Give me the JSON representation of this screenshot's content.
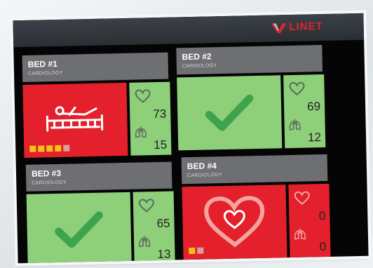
{
  "brand": {
    "name": "LINET"
  },
  "colors": {
    "alarm": "#e3202b",
    "ok": "#8ecf7a",
    "header": "#6d6f72",
    "square_yellow": "#f2c21a",
    "square_grey": "#d9a19b"
  },
  "beds": [
    {
      "title": "BED #1",
      "department": "CARDIOLOGY",
      "status": "alarm",
      "main_icon": "bed-exit-icon",
      "heart_rate": "73",
      "resp_rate": "15",
      "indicators": [
        "yellow",
        "yellow",
        "yellow",
        "yellow",
        "grey"
      ]
    },
    {
      "title": "BED #2",
      "department": "CARDIOLOGY",
      "status": "ok",
      "main_icon": "checkmark-icon",
      "heart_rate": "69",
      "resp_rate": "12",
      "indicators": []
    },
    {
      "title": "BED #3",
      "department": "CARDIOLOGY",
      "status": "ok",
      "main_icon": "checkmark-icon",
      "heart_rate": "65",
      "resp_rate": "13",
      "indicators": []
    },
    {
      "title": "BED #4",
      "department": "CARDIOLOGY",
      "status": "alarm",
      "main_icon": "heart-alarm-icon",
      "heart_rate": "0",
      "resp_rate": "0",
      "indicators": [
        "yellow",
        "grey"
      ]
    }
  ]
}
